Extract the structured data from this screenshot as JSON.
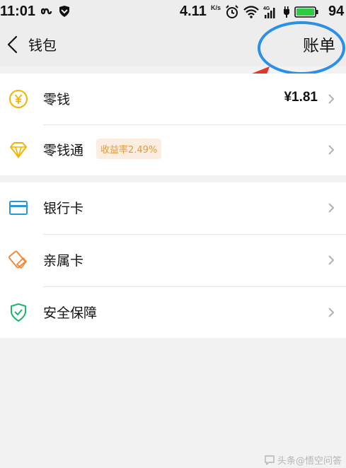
{
  "status_bar": {
    "time": "11:01",
    "network_speed": "4.11",
    "network_speed_unit": "K/s",
    "battery": "94",
    "icons": [
      "infinity-icon",
      "shield-icon",
      "alarm-icon",
      "wifi-icon",
      "signal-4g-icon",
      "signal-icon",
      "charging-icon",
      "battery-icon"
    ]
  },
  "nav": {
    "title": "钱包",
    "right_action": "账单",
    "back_icon": "chevron-left-icon"
  },
  "wallet_items": [
    {
      "label": "零钱",
      "value": "¥1.81",
      "icon": "yuan-coin-icon",
      "color": "#f1b400"
    },
    {
      "label": "零钱通",
      "badge": "收益率2.49%",
      "icon": "diamond-icon",
      "color": "#f1b400"
    }
  ],
  "card_items": [
    {
      "label": "银行卡",
      "icon": "bank-card-icon",
      "color": "#2a97d6"
    },
    {
      "label": "亲属卡",
      "icon": "family-card-icon",
      "color": "#f08a3c"
    },
    {
      "label": "安全保障",
      "icon": "security-shield-icon",
      "color": "#1db46b"
    }
  ],
  "watermark": "头条@悟空问答",
  "colors": {
    "annotation": "#2a8fe6",
    "arrow": "#e8332a",
    "badge_bg": "#fbeee0",
    "badge_text": "#e09a3a",
    "battery": "#2ecc40"
  }
}
